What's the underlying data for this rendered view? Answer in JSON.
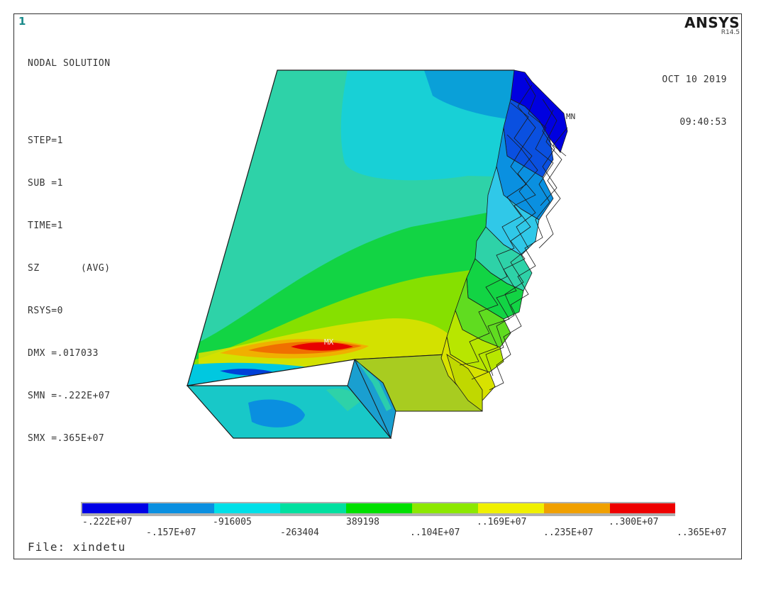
{
  "window_number": "1",
  "solution": {
    "title": "NODAL SOLUTION",
    "step": "STEP=1",
    "sub": "SUB =1",
    "time": "TIME=1",
    "component": "SZ       (AVG)",
    "rsys": "RSYS=0",
    "dmx": "DMX =.017033",
    "smn": "SMN =-.222E+07",
    "smx": "SMX =.365E+07"
  },
  "brand": {
    "name": "ANSYS",
    "release": "R14.5"
  },
  "date": "OCT 10 2019",
  "time_of_day": "09:40:53",
  "markers": {
    "max": "MX",
    "min": "MN"
  },
  "legend": {
    "colors": [
      "#0000e6",
      "#0a8fe0",
      "#00e0e8",
      "#00e0a0",
      "#00e000",
      "#8ce800",
      "#f0f000",
      "#f0a000",
      "#ee0000"
    ],
    "labels": [
      ".222E+07",
      ".157E+07",
      "-916005",
      "-263404",
      "389198",
      ".104E+07",
      ".169E+07",
      ".235E+07",
      ".300E+07",
      ".365E+07"
    ],
    "label_prefix_first": "-",
    "label_prefix_second": "-",
    "label_prefix_decimal": "."
  },
  "file": "File: xindetu"
}
